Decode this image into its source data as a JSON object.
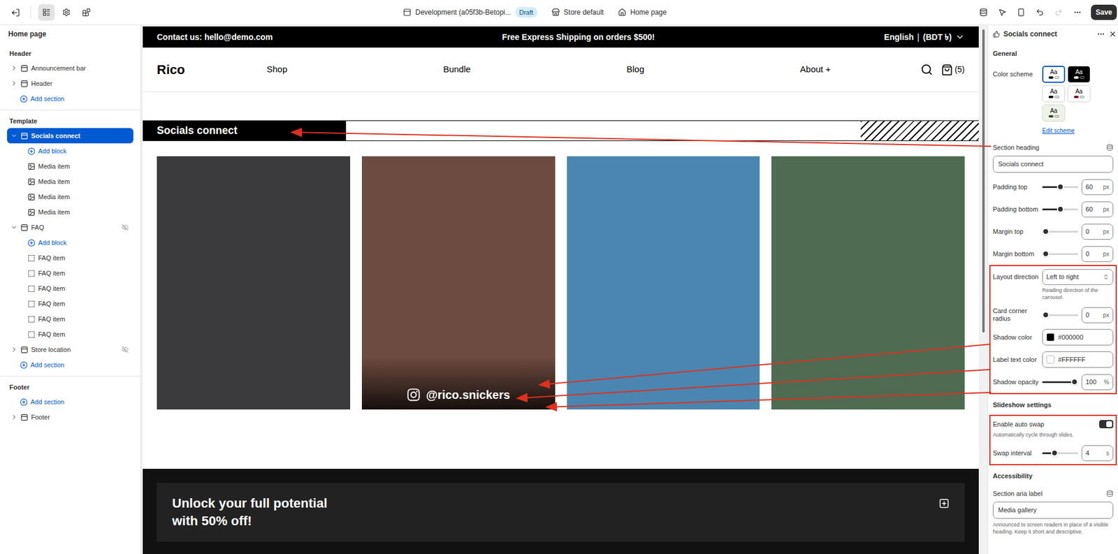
{
  "topbar": {
    "tools": [
      {
        "selected": true
      },
      {
        "selected": false
      },
      {
        "selected": false
      }
    ],
    "theme": "Development (a05f3b-Betopi...",
    "badge": "Draft",
    "context": [
      "Store default",
      "Home page"
    ],
    "undo_disabled": false,
    "redo_disabled": true,
    "save": "Save"
  },
  "sidebar": {
    "title": "Home page",
    "groups": [
      {
        "title": "Header",
        "items": [
          {
            "label": "Announcement bar",
            "kind": "section",
            "selected": false,
            "expanded": false,
            "hidden": false
          },
          {
            "label": "Header",
            "kind": "section",
            "selected": false,
            "expanded": false,
            "hidden": false
          },
          {
            "label": "Add section",
            "kind": "add-section",
            "selected": false
          }
        ]
      },
      {
        "title": "Template",
        "items": [
          {
            "label": "Socials connect",
            "kind": "section",
            "selected": true,
            "expanded": true,
            "hidden": false
          },
          {
            "label": "Add block",
            "kind": "add-block",
            "selected": false
          },
          {
            "label": "Media item",
            "kind": "media",
            "selected": false
          },
          {
            "label": "Media item",
            "kind": "media",
            "selected": false
          },
          {
            "label": "Media item",
            "kind": "media",
            "selected": false
          },
          {
            "label": "Media item",
            "kind": "media",
            "selected": false
          },
          {
            "label": "FAQ",
            "kind": "section",
            "selected": false,
            "expanded": true,
            "hidden": true
          },
          {
            "label": "Add block",
            "kind": "add-block",
            "selected": false
          },
          {
            "label": "FAQ item",
            "kind": "item",
            "selected": false
          },
          {
            "label": "FAQ item",
            "kind": "item",
            "selected": false
          },
          {
            "label": "FAQ item",
            "kind": "item",
            "selected": false
          },
          {
            "label": "FAQ item",
            "kind": "item",
            "selected": false
          },
          {
            "label": "FAQ item",
            "kind": "item",
            "selected": false
          },
          {
            "label": "FAQ item",
            "kind": "item",
            "selected": false
          },
          {
            "label": "Store location",
            "kind": "section",
            "selected": false,
            "expanded": false,
            "hidden": true
          },
          {
            "label": "Add section",
            "kind": "add-section",
            "selected": false
          }
        ]
      },
      {
        "title": "Footer",
        "items": [
          {
            "label": "Add section",
            "kind": "add-section",
            "selected": false
          },
          {
            "label": "Footer",
            "kind": "section",
            "selected": false,
            "expanded": false,
            "hidden": false
          }
        ]
      }
    ]
  },
  "preview": {
    "announcement": {
      "contact": "Contact us: hello@demo.com",
      "message": "Free Express Shipping on orders $500!",
      "language": "English",
      "separator": "|",
      "currency": "(BDT ৳)"
    },
    "header": {
      "logo": "Rico",
      "nav": [
        "Shop",
        "Bundle",
        "Blog",
        "About +"
      ],
      "cart_count": "(5)"
    },
    "socials": {
      "heading": "Socials connect",
      "media": [
        {
          "color": "#3b3b3d"
        },
        {
          "color": "#6e4b40",
          "label": "@rico.snickers"
        },
        {
          "color": "#4a86b0"
        },
        {
          "color": "#4f6b52"
        }
      ]
    },
    "faq": {
      "heading": [
        "Unlock your full potential",
        "with 50% off!"
      ]
    }
  },
  "panel": {
    "title": "Socials connect",
    "groups": [
      {
        "highlighted": false,
        "items": [
          {
            "kind": "heading",
            "label": "General"
          },
          {
            "kind": "schemes",
            "label": "Color scheme",
            "options": [
              {
                "text": "Aa",
                "selected": true,
                "bg": "#ffffff",
                "fg": "#000000",
                "color": "#000000"
              },
              {
                "text": "Aa",
                "selected": false,
                "bg": "#000000",
                "fg": "#ffffff",
                "color": "#ffffff"
              },
              {
                "text": "Aa",
                "selected": false,
                "bg": "#ffffff",
                "fg": "#000000",
                "color": "#000000"
              },
              {
                "text": "Aa",
                "selected": false,
                "bg": "#ffffff",
                "fg": "#000000",
                "color": "#7a1020"
              },
              {
                "text": "Aa",
                "selected": false,
                "bg": "#eef3e8",
                "fg": "#000000",
                "color": "#2e4a2a"
              }
            ]
          },
          {
            "kind": "link",
            "label": "Edit scheme"
          },
          {
            "kind": "text",
            "label": "Section heading",
            "value": "Socials connect"
          },
          {
            "kind": "slider",
            "label": "Padding top",
            "value": "60",
            "unit": "px",
            "level": 0.5
          },
          {
            "kind": "slider",
            "label": "Padding bottom",
            "value": "60",
            "unit": "px",
            "level": 0.5
          },
          {
            "kind": "slider",
            "label": "Margin top",
            "value": "0",
            "unit": "px",
            "level": 0
          },
          {
            "kind": "slider",
            "label": "Margin bottom",
            "value": "0",
            "unit": "px",
            "level": 0
          }
        ]
      },
      {
        "highlighted": true,
        "items": [
          {
            "kind": "select",
            "label": "Layout direction",
            "value": "Left to right",
            "help": "Reading direction of the carousel."
          },
          {
            "kind": "slider",
            "label": "Card corner radius",
            "value": "0",
            "unit": "px",
            "level": 0
          },
          {
            "kind": "color",
            "label": "Shadow color",
            "value": "#000000",
            "color": "#000000"
          },
          {
            "kind": "color",
            "label": "Label text color",
            "value": "#FFFFFF",
            "color": "#FFFFFF"
          },
          {
            "kind": "slider",
            "label": "Shadow opacity",
            "value": "100",
            "unit": "%",
            "level": 1
          }
        ]
      },
      {
        "highlighted": false,
        "items": [
          {
            "kind": "heading",
            "label": "Slideshow settings"
          }
        ]
      },
      {
        "highlighted": true,
        "items": [
          {
            "kind": "toggle",
            "label": "Enable auto swap",
            "on": true,
            "help": "Automatically cycle through slides."
          },
          {
            "kind": "slider",
            "label": "Swap interval",
            "value": "4",
            "unit": "s",
            "level": 0.3
          }
        ]
      },
      {
        "highlighted": false,
        "items": [
          {
            "kind": "heading",
            "label": "Accessibility"
          },
          {
            "kind": "text",
            "label": "Section aria label",
            "value": "Media gallery",
            "help": "Announced to screen readers in place of a visible heading. Keep it short and descriptive."
          }
        ]
      }
    ]
  }
}
